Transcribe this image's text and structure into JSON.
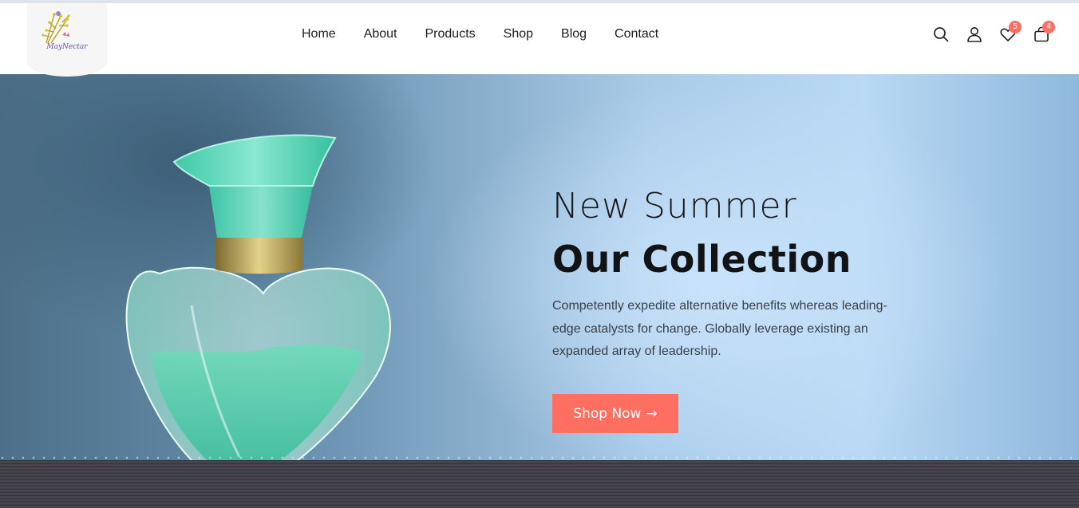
{
  "brand": {
    "logo_text": "MayNectar"
  },
  "nav": {
    "items": [
      {
        "label": "Home"
      },
      {
        "label": "About"
      },
      {
        "label": "Products"
      },
      {
        "label": "Shop"
      },
      {
        "label": "Blog"
      },
      {
        "label": "Contact"
      }
    ]
  },
  "header_icons": {
    "search": "search-icon",
    "account": "user-icon",
    "wishlist": {
      "icon": "heart-icon",
      "count": "5"
    },
    "cart": {
      "icon": "shopping-bag-icon",
      "count": "4"
    }
  },
  "hero": {
    "subtitle": "New Summer",
    "title": "Our Collection",
    "description": "Competently expedite alternative benefits whereas leading-edge catalysts for change. Globally leverage existing an expanded array of leadership.",
    "cta_label": "Shop Now",
    "cta_icon": "arrow-right-icon"
  },
  "colors": {
    "accent": "#ff6f61",
    "text_dark": "#111316",
    "bottle_green": "#3fd1b0"
  }
}
